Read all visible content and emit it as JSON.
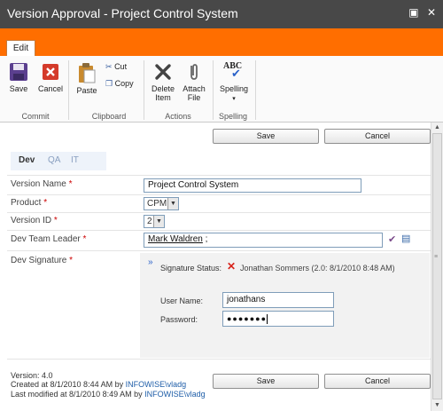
{
  "window": {
    "title": "Version Approval - Project Control System",
    "restore_glyph": "▣",
    "close_glyph": "✕"
  },
  "ribbon": {
    "tab": "Edit",
    "save": "Save",
    "cancel": "Cancel",
    "paste": "Paste",
    "cut": "Cut",
    "copy": "Copy",
    "delete_item_1": "Delete",
    "delete_item_2": "Item",
    "attach_file_1": "Attach",
    "attach_file_2": "File",
    "spelling": "Spelling",
    "spelling_icon_text": "ABC",
    "groups": {
      "commit": "Commit",
      "clipboard": "Clipboard",
      "actions": "Actions",
      "spelling": "Spelling"
    }
  },
  "buttons": {
    "save": "Save",
    "cancel": "Cancel"
  },
  "tabs": [
    "Dev",
    "QA",
    "IT"
  ],
  "form": {
    "version_name": {
      "label": "Version Name",
      "value": "Project Control System"
    },
    "product": {
      "label": "Product",
      "value": "CPM"
    },
    "version_id": {
      "label": "Version ID",
      "value": "2"
    },
    "dev_team_leader": {
      "label": "Dev Team Leader",
      "value": "Mark Waldren",
      "suffix": " ;"
    },
    "dev_signature": {
      "label": "Dev Signature",
      "status_label": "Signature Status:",
      "status_value": "Jonathan Sommers (2.0: 8/1/2010 8:48 AM)",
      "username_label": "User Name:",
      "username_value": "jonathans",
      "password_label": "Password:",
      "password_value": "●●●●●●●"
    },
    "required_mark": "*"
  },
  "footer": {
    "version": "Version: 4.0",
    "created_prefix": "Created at 8/1/2010 8:44 AM by ",
    "created_by": "INFOWISE\\vladg",
    "modified_prefix": "Last modified at 8/1/2010 8:49 AM by ",
    "modified_by": "INFOWISE\\vladg"
  },
  "colors": {
    "titlebar": "#484848",
    "brand_orange": "#ff6e00",
    "link": "#1f5ea8",
    "required": "#cc0000",
    "error_x": "#d8231b"
  }
}
